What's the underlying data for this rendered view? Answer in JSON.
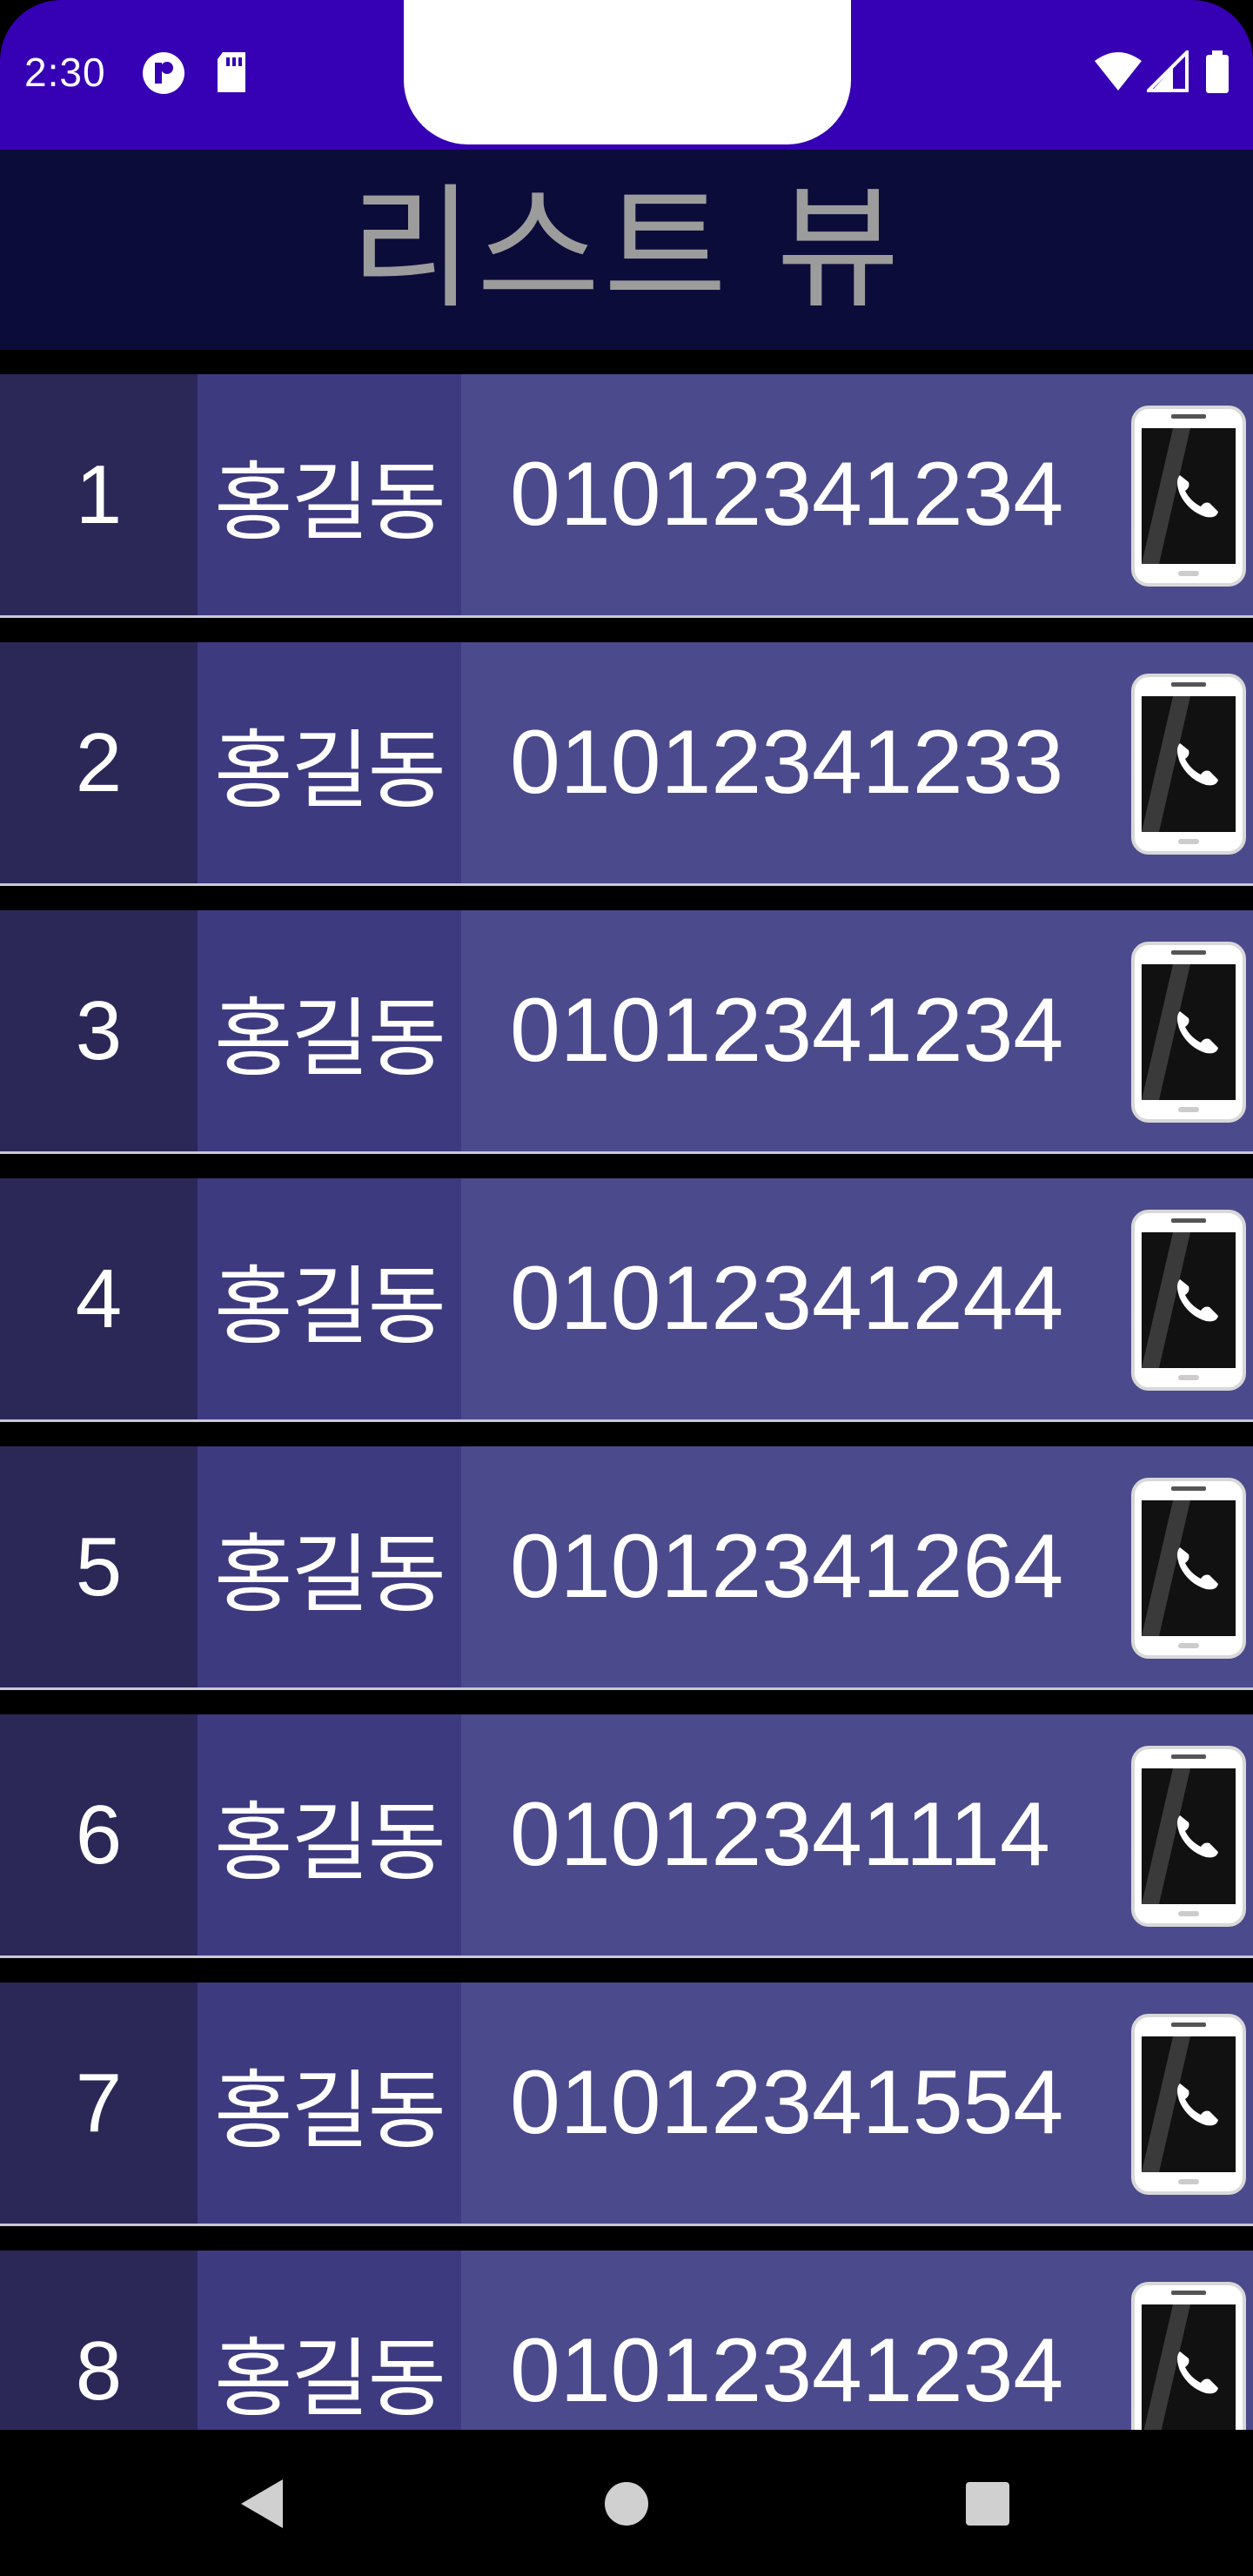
{
  "status_bar": {
    "time": "2:30",
    "left_icons": [
      "notification-icon",
      "sd-card-icon"
    ],
    "right_icons": [
      "wifi-icon",
      "cell-signal-icon",
      "battery-icon"
    ],
    "color": "#3600b4"
  },
  "app_bar": {
    "title": "리스트 뷰",
    "background": "#0b0c3a"
  },
  "list": {
    "items": [
      {
        "num": "1",
        "name": "홍길동",
        "phone": "01012341234",
        "icon": "phone-icon"
      },
      {
        "num": "2",
        "name": "홍길동",
        "phone": "01012341233",
        "icon": "phone-icon"
      },
      {
        "num": "3",
        "name": "홍길동",
        "phone": "01012341234",
        "icon": "phone-icon"
      },
      {
        "num": "4",
        "name": "홍길동",
        "phone": "01012341244",
        "icon": "phone-icon"
      },
      {
        "num": "5",
        "name": "홍길동",
        "phone": "01012341264",
        "icon": "phone-icon"
      },
      {
        "num": "6",
        "name": "홍길동",
        "phone": "01012341114",
        "icon": "phone-icon"
      },
      {
        "num": "7",
        "name": "홍길동",
        "phone": "01012341554",
        "icon": "phone-icon"
      },
      {
        "num": "8",
        "name": "홍길동",
        "phone": "01012341234",
        "icon": "phone-icon"
      }
    ]
  },
  "nav_bar": {
    "buttons": [
      "back-icon",
      "home-icon",
      "recents-icon"
    ]
  }
}
